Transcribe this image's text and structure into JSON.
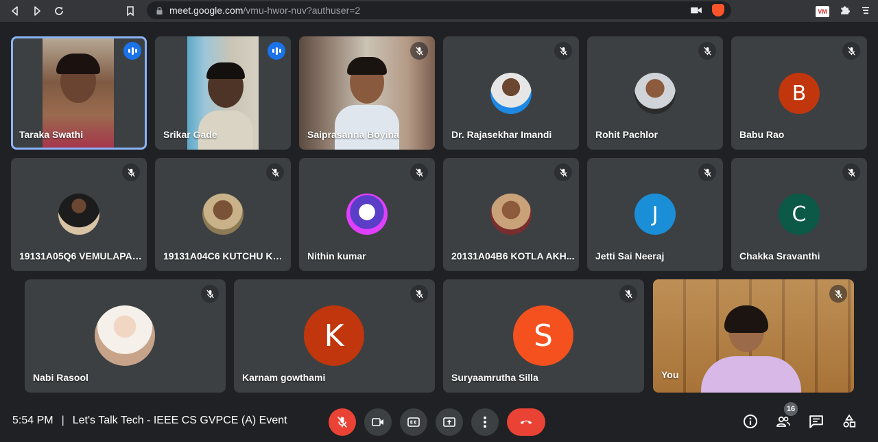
{
  "browser": {
    "url_host": "meet.google.com",
    "url_path": "/vmu-hwor-nuv?authuser=2",
    "extension_label": "VM"
  },
  "participants": [
    {
      "name": "Taraka Swathi",
      "status": "speaking",
      "kind": "video"
    },
    {
      "name": "Srikar Gade",
      "status": "speaking",
      "kind": "video"
    },
    {
      "name": "Saiprasanna Boyina",
      "status": "muted",
      "kind": "video"
    },
    {
      "name": "Dr. Rajasekhar Imandi",
      "status": "muted",
      "kind": "photo-avatar"
    },
    {
      "name": "Rohit Pachlor",
      "status": "muted",
      "kind": "photo-avatar"
    },
    {
      "name": "Babu Rao",
      "status": "muted",
      "kind": "letter-avatar",
      "initial": "B",
      "color": "#c1360c"
    },
    {
      "name": "19131A05Q6 VEMULAPAL...",
      "status": "muted",
      "kind": "photo-avatar"
    },
    {
      "name": "19131A04C6 KUTCHU KO...",
      "status": "muted",
      "kind": "photo-avatar"
    },
    {
      "name": "Nithin kumar",
      "status": "muted",
      "kind": "photo-avatar"
    },
    {
      "name": "20131A04B6 KOTLA AKH...",
      "status": "muted",
      "kind": "photo-avatar"
    },
    {
      "name": "Jetti Sai Neeraj",
      "status": "muted",
      "kind": "letter-avatar",
      "initial": "J",
      "color": "#1a8fd8"
    },
    {
      "name": "Chakka Sravanthi",
      "status": "muted",
      "kind": "letter-avatar",
      "initial": "C",
      "color": "#0b5946"
    },
    {
      "name": "Nabi Rasool",
      "status": "muted",
      "kind": "photo-avatar"
    },
    {
      "name": "Karnam gowthami",
      "status": "muted",
      "kind": "letter-avatar",
      "initial": "K",
      "color": "#c1360c"
    },
    {
      "name": "Suryaamrutha Silla",
      "status": "muted",
      "kind": "letter-avatar",
      "initial": "S",
      "color": "#f4511e"
    },
    {
      "name": "You",
      "status": "muted",
      "kind": "video"
    }
  ],
  "meeting": {
    "time": "5:54 PM",
    "separator": "|",
    "title": "Let's Talk Tech - IEEE CS GVPCE (A) Event"
  },
  "controls": {
    "mic_color": "#ea4335",
    "hangup_color": "#ea4335",
    "participant_count": "16"
  },
  "colors": {
    "background": "#202124",
    "tile": "#3c4043",
    "speaking_ring": "#8ab4f8",
    "speaking_badge": "#1a73e8"
  }
}
